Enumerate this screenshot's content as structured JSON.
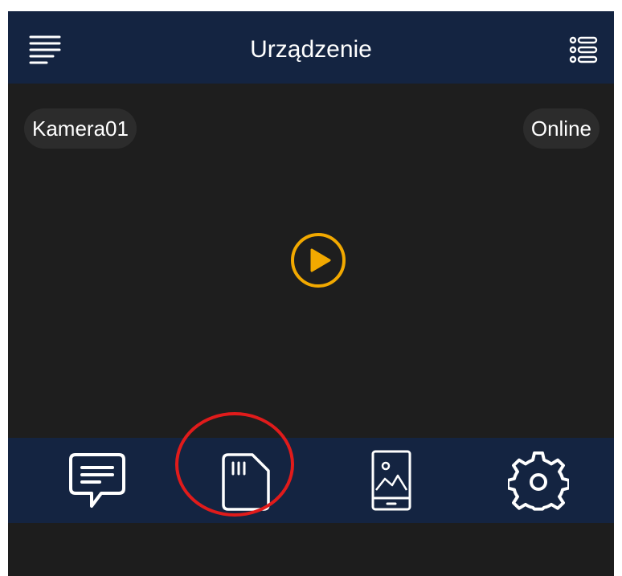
{
  "header": {
    "title": "Urządzenie",
    "menu_icon": "hamburger-menu-icon",
    "list_icon": "device-list-icon"
  },
  "video": {
    "camera_name": "Kamera01",
    "status": "Online",
    "play_icon": "play-icon"
  },
  "toolbar": {
    "items": [
      {
        "icon": "message-icon"
      },
      {
        "icon": "sd-card-icon"
      },
      {
        "icon": "phone-gallery-icon"
      },
      {
        "icon": "gear-icon"
      }
    ]
  },
  "colors": {
    "header_bg": "#142441",
    "screen_bg": "#1d1d1d",
    "accent_play": "#f2a900",
    "highlight_ring": "#e01b1b",
    "pill_bg": "#2c2c2c"
  }
}
